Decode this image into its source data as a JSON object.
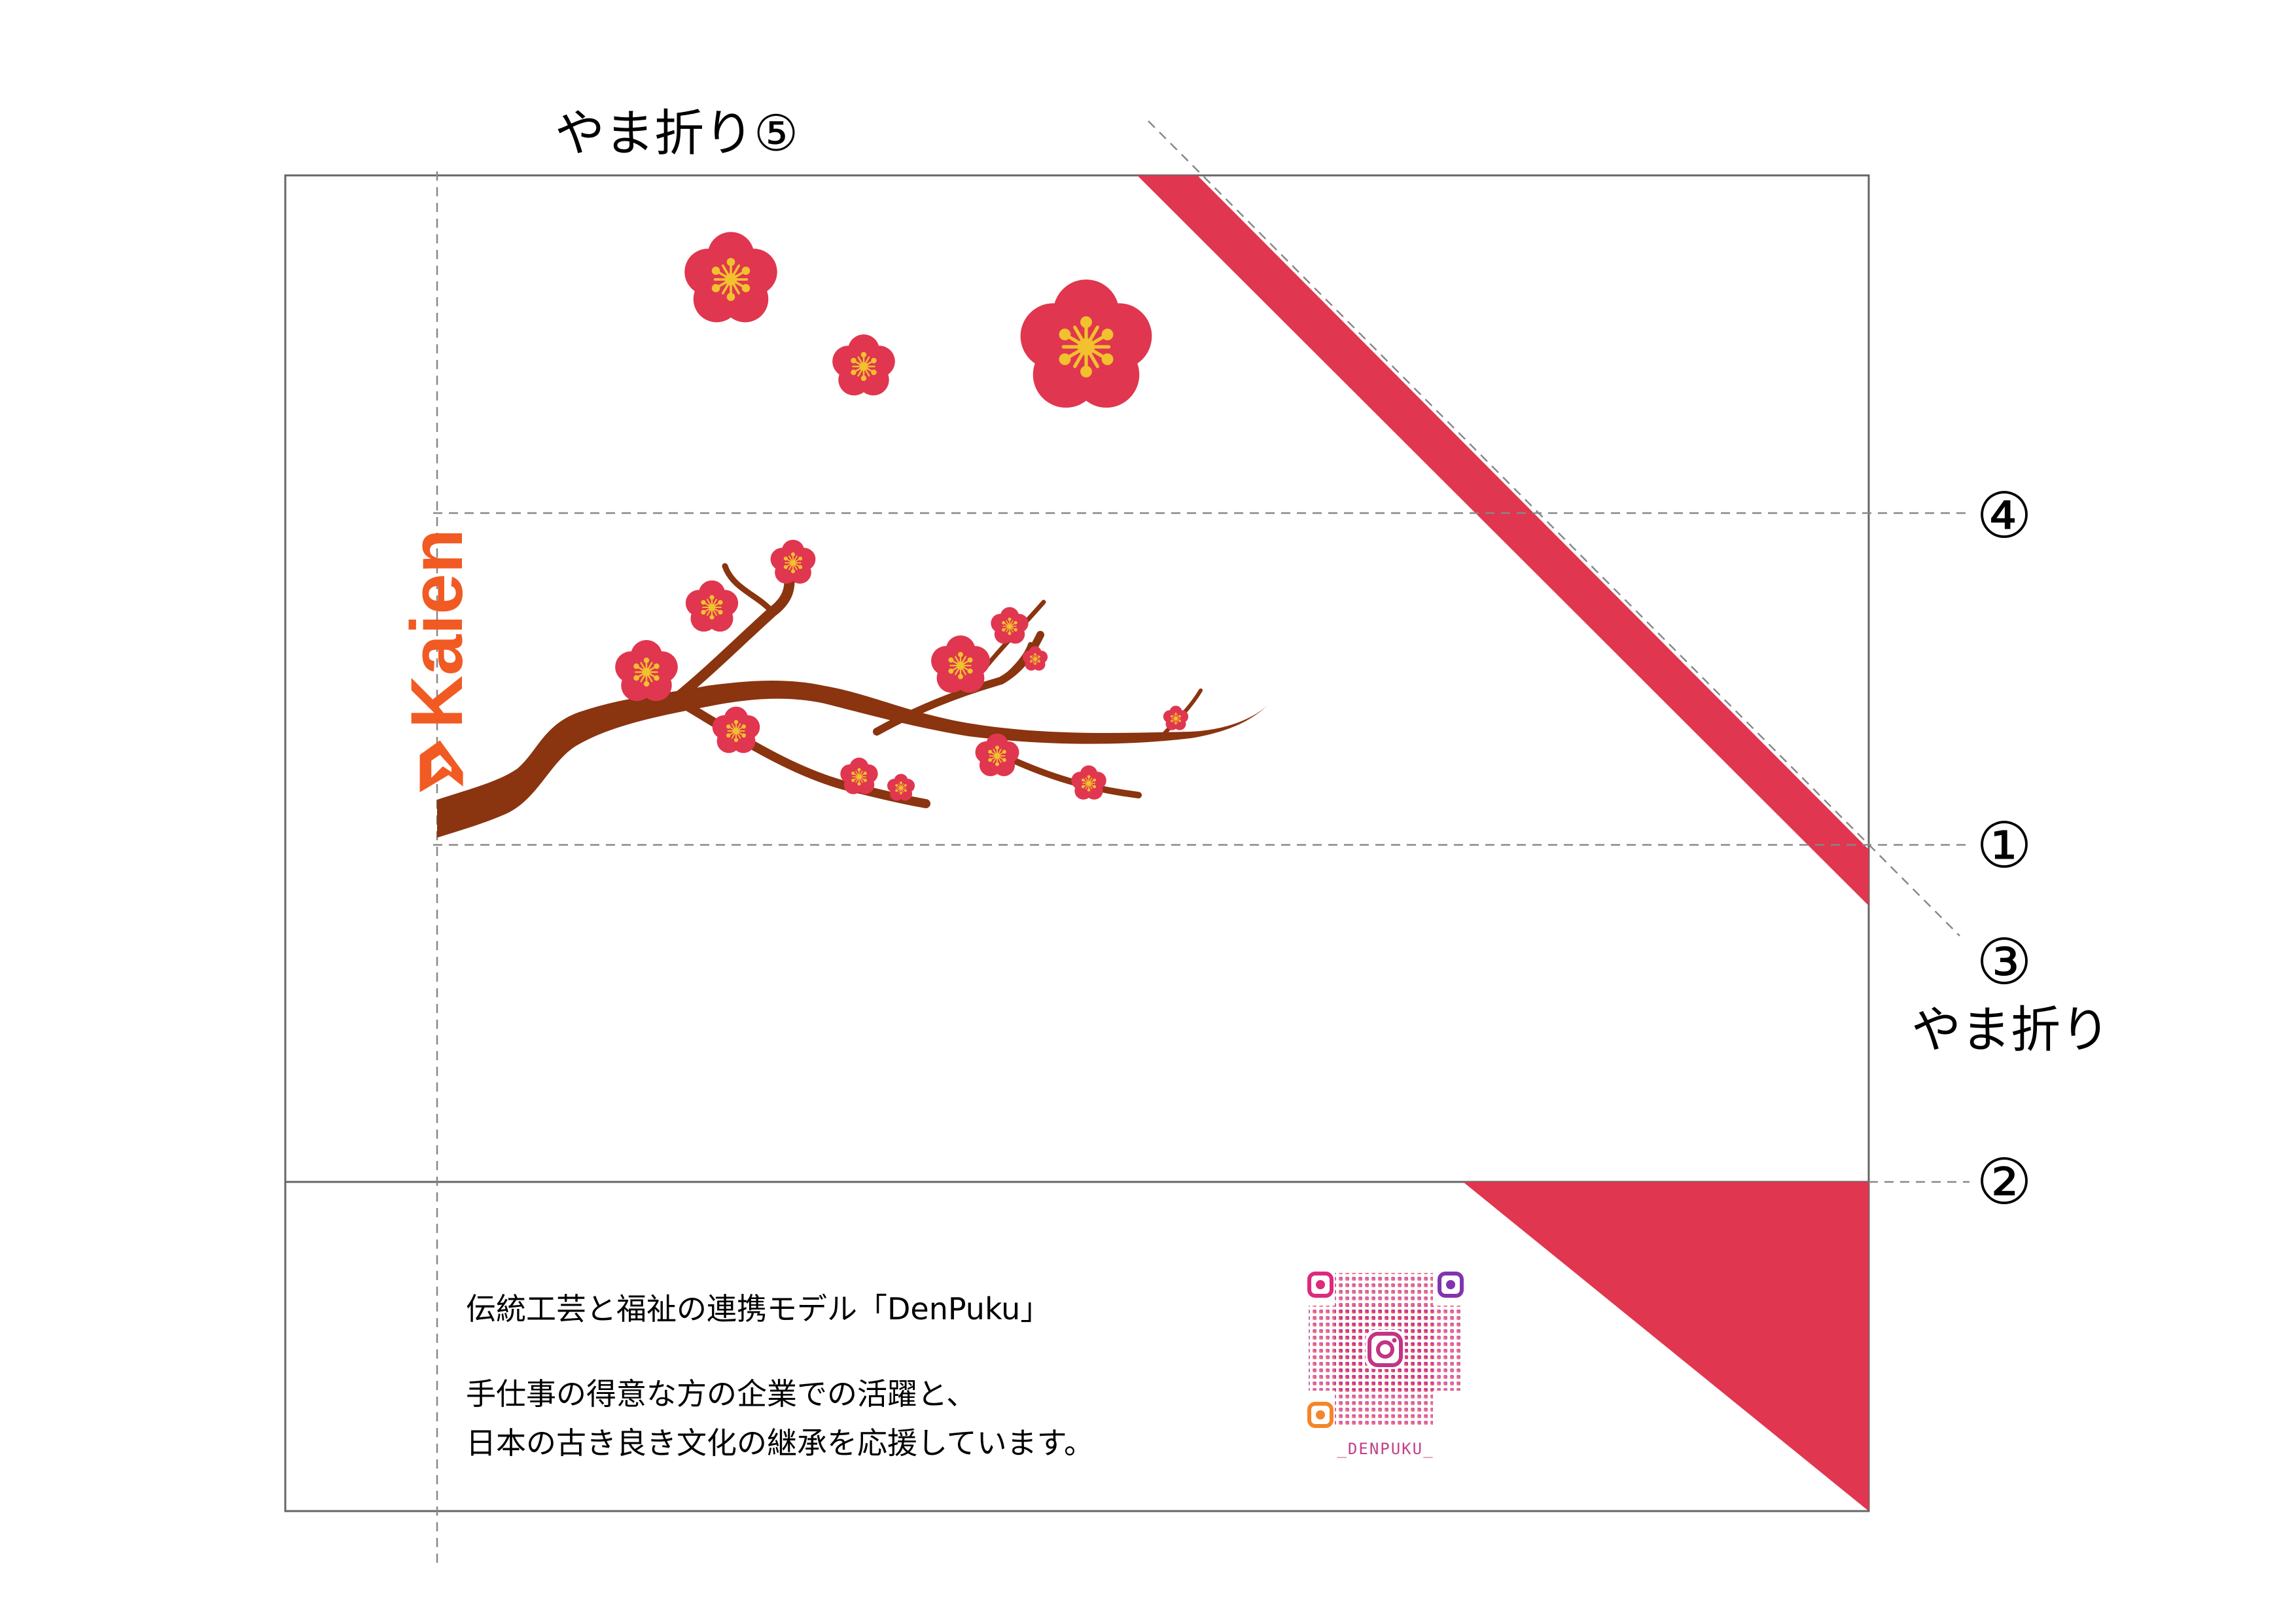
{
  "fold_labels": {
    "top": "やま折り⑤",
    "right": "やま折り"
  },
  "markers": {
    "m4": "④",
    "m1": "①",
    "m3": "③",
    "m2": "②"
  },
  "logo": {
    "text": "Kaien",
    "color": "#f15a22"
  },
  "message": {
    "line1": "伝統工芸と福祉の連携モデル「DenPuku」",
    "line2": "手仕事の得意な方の企業での活躍と、",
    "line3": "日本の古き良き文化の継承を応援しています。"
  },
  "qr": {
    "label": "_DENPUKU_"
  },
  "colors": {
    "accent_red": "#e0364f",
    "blossom_center": "#f2c12e",
    "branch": "#8a3410",
    "guide_line": "#888888",
    "border": "#666666"
  },
  "icons": [
    "plum-blossom-icon",
    "branch-icon",
    "kaien-logo-icon",
    "instagram-icon",
    "qr-code"
  ]
}
